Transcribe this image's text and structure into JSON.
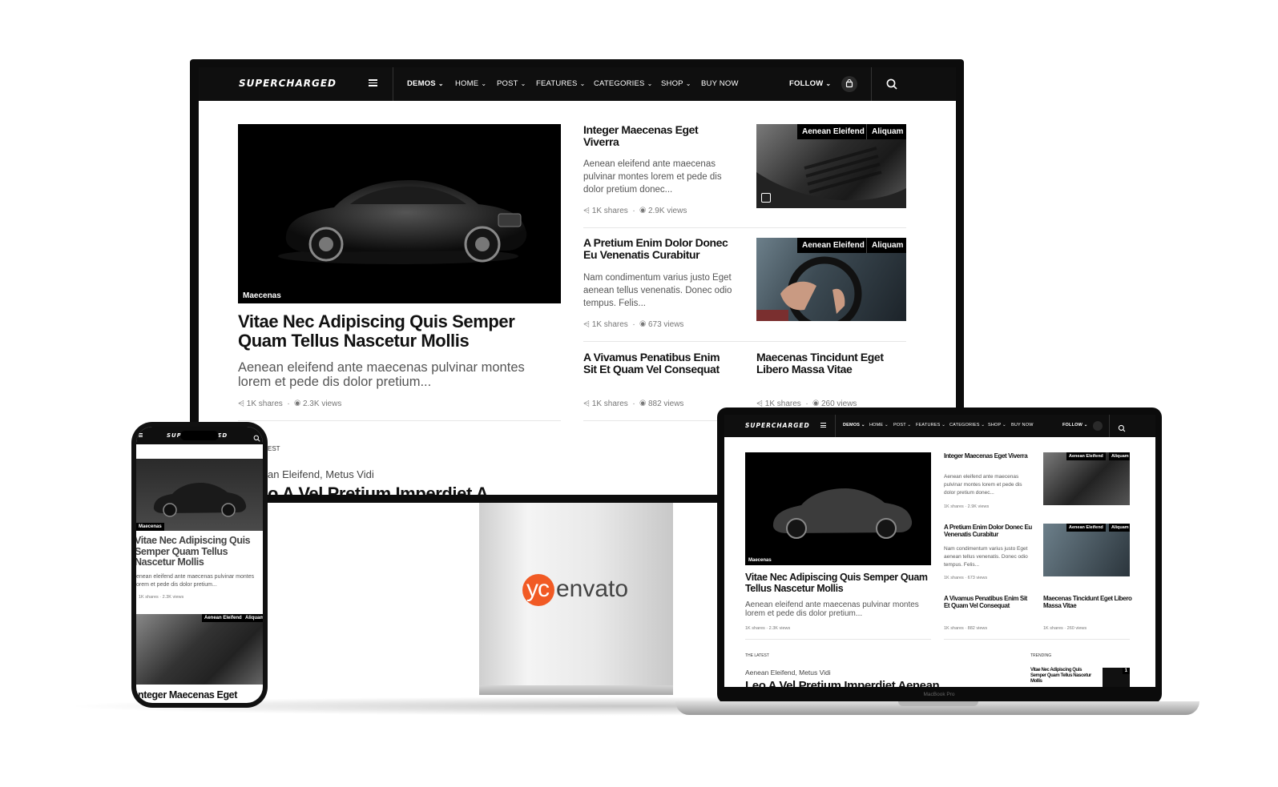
{
  "site": {
    "logo": "SUPERCHARGED",
    "nav": [
      "DEMOS",
      "HOME",
      "POST",
      "FEATURES",
      "CATEGORIES",
      "SHOP",
      "BUY NOW"
    ],
    "follow": "FOLLOW",
    "icons": [
      "menu-icon",
      "chevron-down-icon",
      "cart-icon",
      "search-icon",
      "share-icon",
      "eye-icon",
      "image-icon"
    ]
  },
  "featured": {
    "category": "Maecenas",
    "title": "Vitae Nec Adipiscing Quis Semper Quam Tellus Nascetur Mollis",
    "excerpt": "Aenean eleifend ante maecenas pulvinar montes lorem et pede dis dolor pretium...",
    "shares": "1K shares",
    "views": "2.3K views"
  },
  "posts": [
    {
      "title": "Integer Maecenas Eget Viverra",
      "excerpt": "Aenean eleifend ante maecenas pulvinar montes lorem et pede dis dolor pretium donec...",
      "shares": "1K shares",
      "views": "2.9K views",
      "tags": [
        "Aenean Eleifend",
        "Aliquam"
      ]
    },
    {
      "title": "A Pretium Enim Dolor Donec Eu Venenatis Curabitur",
      "excerpt": "Nam condimentum varius justo Eget aenean tellus venenatis. Donec odio tempus. Felis...",
      "shares": "1K shares",
      "views": "673 views",
      "tags": [
        "Aenean Eleifend",
        "Aliquam"
      ]
    },
    {
      "title": "A Vivamus Penatibus Enim Sit Et Quam Vel Consequat",
      "shares": "1K shares",
      "views": "882 views"
    },
    {
      "title": "Maecenas Tincidunt Eget Libero Massa Vitae",
      "shares": "1K shares",
      "views": "260 views"
    }
  ],
  "latest": {
    "heading": "THE LATEST",
    "heading_cut": "EST",
    "authors": [
      "Aenean Eleifend,",
      "Metus Vidi"
    ],
    "author_cut": "an Eleifend,",
    "post_title": "Leo A Vel Pretium Imperdiet Aenean",
    "post_title_cut": "o A Vel Pretium Imperdiet A",
    "trending": "TRENDING",
    "trending_post": "Vitae Nec Adipiscing Quis Semper Quam Tellus Nascetur Mollis",
    "trending_rank": "1"
  },
  "phone": {
    "title_cut": "Vitae Nec Adipiscing Quis Semper Quam Tellus Nascetur Mollis",
    "excerpt_cut": "enean eleifend ante maecenas pulvinar montes orem et pede dis dolor pretium...",
    "tag_cut": "Aliquam",
    "next_title_cut": "nteger Maecenas Eget"
  },
  "brand": {
    "envato_prefix": "yc",
    "envato": "envato",
    "envato_color": "#f15a24"
  },
  "device_label": "MacBook Pro"
}
